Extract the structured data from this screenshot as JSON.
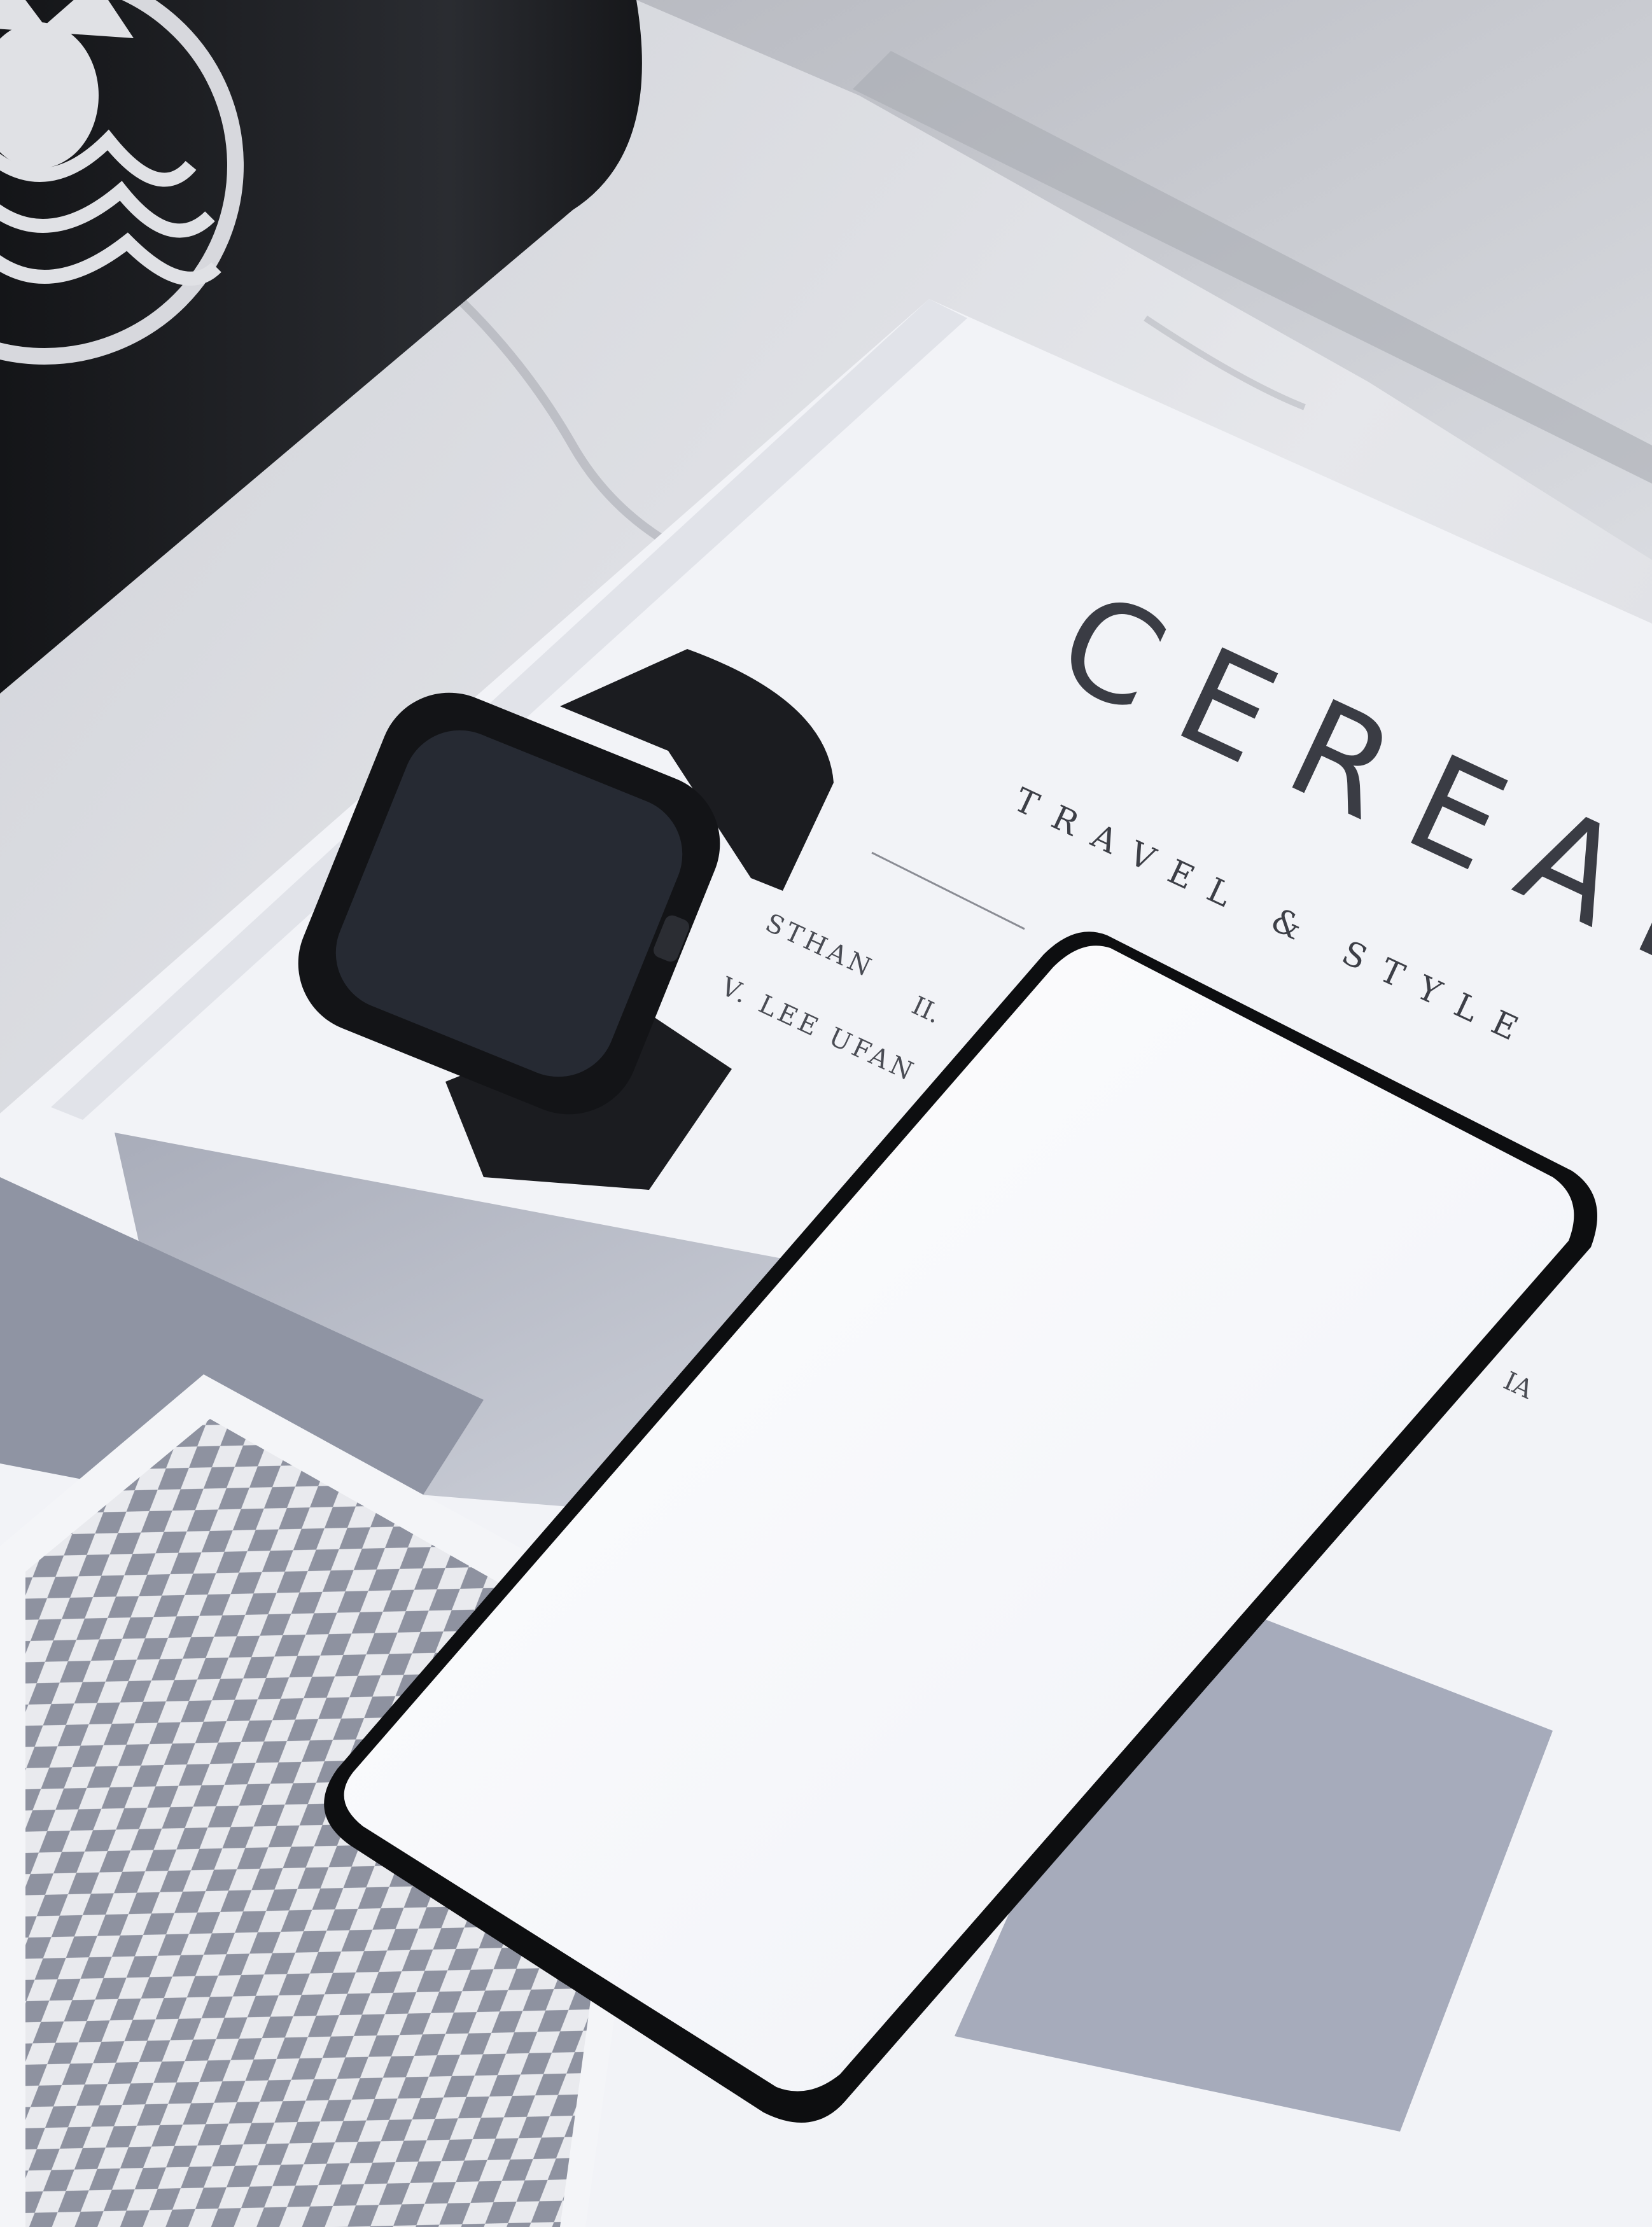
{
  "magazine": {
    "title": "CEREAL",
    "subtitle": "TRAVEL & STYLE",
    "contents": [
      "STHAN",
      "II.",
      "V. LEE UFAN",
      "IA"
    ]
  },
  "colors": {
    "marble": "#e4e5e9",
    "page": "#f2f3f7",
    "print_light": "#c9ccd5",
    "print_dark": "#9ea3b1",
    "cup": "#1f2024",
    "device_body": "#0d0e10",
    "screen": "#f7f8fc",
    "watch_screen": "#262a33"
  },
  "icons": {
    "cup_logo": "siren-logo",
    "phone": "smartphone",
    "watch": "smartwatch"
  }
}
